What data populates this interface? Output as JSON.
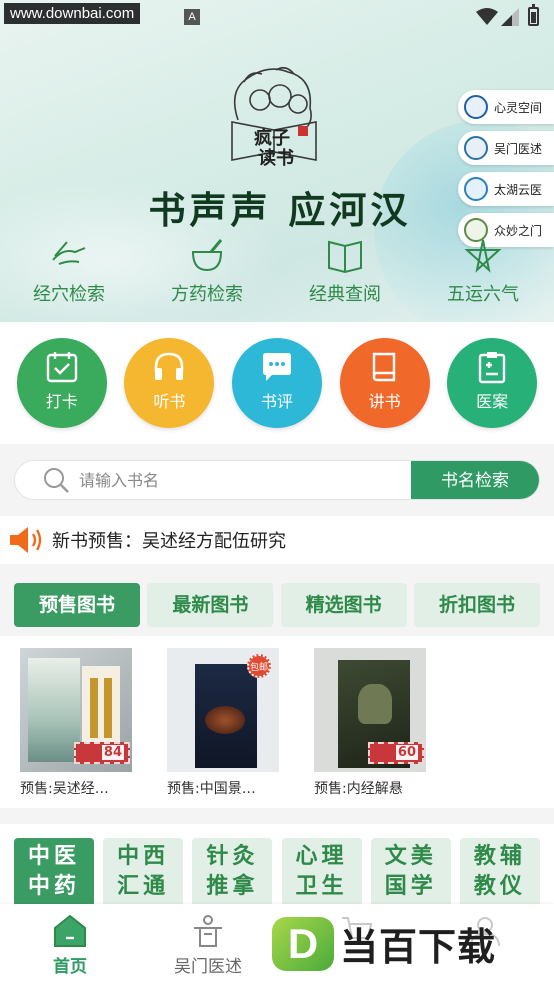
{
  "status_bar": {
    "watermark": "www.downbai.com",
    "indicator": "A"
  },
  "hero": {
    "logo_text": [
      "疯子",
      "读书"
    ],
    "slogan": "书声声 应河汉",
    "side_links": [
      {
        "label": "心灵空间",
        "icon": "heart-logo-icon",
        "color": "#1f5fa8"
      },
      {
        "label": "吴门医述",
        "icon": "circle-seal-icon",
        "color": "#2a6fa6"
      },
      {
        "label": "太湖云医",
        "icon": "cloud-e-icon",
        "color": "#2a7fc0"
      },
      {
        "label": "众妙之门",
        "icon": "gate-icon",
        "color": "#5b8a4a"
      }
    ],
    "nav": [
      {
        "label": "经穴检索",
        "icon": "hand-acupoint-icon"
      },
      {
        "label": "方药检索",
        "icon": "mortar-icon"
      },
      {
        "label": "经典查阅",
        "icon": "open-book-icon"
      },
      {
        "label": "五运六气",
        "icon": "pentagram-icon"
      }
    ]
  },
  "actions": [
    {
      "label": "打卡",
      "icon": "calendar-check-icon",
      "color": "#3aaa5c"
    },
    {
      "label": "听书",
      "icon": "headphones-icon",
      "color": "#f6b730"
    },
    {
      "label": "书评",
      "icon": "chat-bubble-icon",
      "color": "#2eb8d8"
    },
    {
      "label": "讲书",
      "icon": "book-icon",
      "color": "#f0682a"
    },
    {
      "label": "医案",
      "icon": "clipboard-plus-icon",
      "color": "#28b079"
    }
  ],
  "search": {
    "placeholder": "请输入书名",
    "button": "书名检索"
  },
  "announcement": {
    "label": "新书预售：",
    "text": "吴述经方配伍研究"
  },
  "tabs": [
    "预售图书",
    "最新图书",
    "精选图书",
    "折扣图书"
  ],
  "books": [
    {
      "title": "预售:吴述经…",
      "price": "84",
      "badge": ""
    },
    {
      "title": "预售:中国景…",
      "price": "",
      "badge": "包邮"
    },
    {
      "title": "预售:内经解悬",
      "price": "60",
      "badge": ""
    }
  ],
  "categories": [
    [
      "中医",
      "中药"
    ],
    [
      "中西",
      "汇通"
    ],
    [
      "针灸",
      "推拿"
    ],
    [
      "心理",
      "卫生"
    ],
    [
      "文美",
      "国学"
    ],
    [
      "教辅",
      "教仪"
    ]
  ],
  "bottom_nav": {
    "home": "首页",
    "wumen": "吴门医述",
    "brand": "当百下载",
    "brand_letter": "D"
  }
}
